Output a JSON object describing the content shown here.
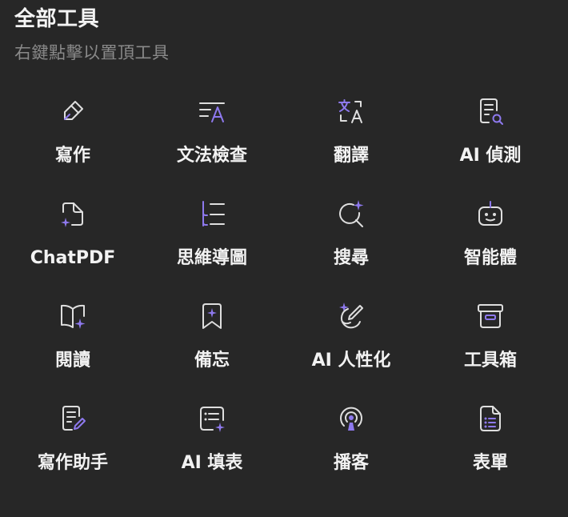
{
  "header": {
    "title": "全部工具",
    "subtitle": "右鍵點擊以置頂工具"
  },
  "accent_color": "#8e79ee",
  "tools": [
    {
      "label": "寫作",
      "icon": "pencil-icon"
    },
    {
      "label": "文法檢查",
      "icon": "grammar-check-icon"
    },
    {
      "label": "翻譯",
      "icon": "translate-icon"
    },
    {
      "label": "AI 偵測",
      "icon": "document-search-icon"
    },
    {
      "label": "ChatPDF",
      "icon": "pdf-sparkle-icon"
    },
    {
      "label": "思維導圖",
      "icon": "mind-map-icon"
    },
    {
      "label": "搜尋",
      "icon": "search-sparkle-icon"
    },
    {
      "label": "智能體",
      "icon": "robot-icon"
    },
    {
      "label": "閱讀",
      "icon": "book-sparkle-icon"
    },
    {
      "label": "備忘",
      "icon": "bookmark-sparkle-icon"
    },
    {
      "label": "AI 人性化",
      "icon": "humanize-icon"
    },
    {
      "label": "工具箱",
      "icon": "toolbox-icon"
    },
    {
      "label": "寫作助手",
      "icon": "writing-assistant-icon"
    },
    {
      "label": "AI 填表",
      "icon": "form-fill-icon"
    },
    {
      "label": "播客",
      "icon": "podcast-icon"
    },
    {
      "label": "表單",
      "icon": "form-icon"
    }
  ]
}
